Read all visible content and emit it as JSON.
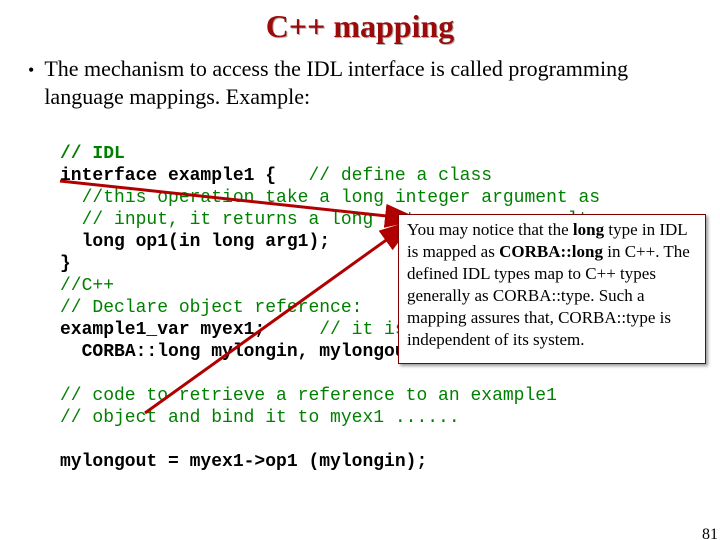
{
  "title": "C++ mapping",
  "bullet": "The mechanism to access the IDL interface is called programming language mappings. Example:",
  "code": {
    "l1": "// IDL",
    "l2": "interface example1 {",
    "l2c": "   // define a class",
    "l3": "//this operation take a long integer argument as",
    "l4": "// input, it returns a long integer as a result",
    "l5": "long op1(in long arg1);",
    "l6": "}",
    "l7": "//C++",
    "l8": "// Declare object reference:",
    "l9a": "example1_var myex1;",
    "l9b": "     // it is of type example1",
    "l10": "CORBA::long mylongin, mylongout;",
    "l11": "// code to retrieve a reference to an example1",
    "l12": "// object and bind it to myex1 ......",
    "l13": "mylongout = myex1->op1 (mylongin);"
  },
  "callout": {
    "t1": "You may notice that the ",
    "t2": "long",
    "t3": " type in IDL is mapped as ",
    "t4": "CORBA::long",
    "t5": " in C++. The defined IDL types map to C++ types generally as CORBA::type. Such a mapping assures that, CORBA::type is independent of its system."
  },
  "page_number": "81"
}
